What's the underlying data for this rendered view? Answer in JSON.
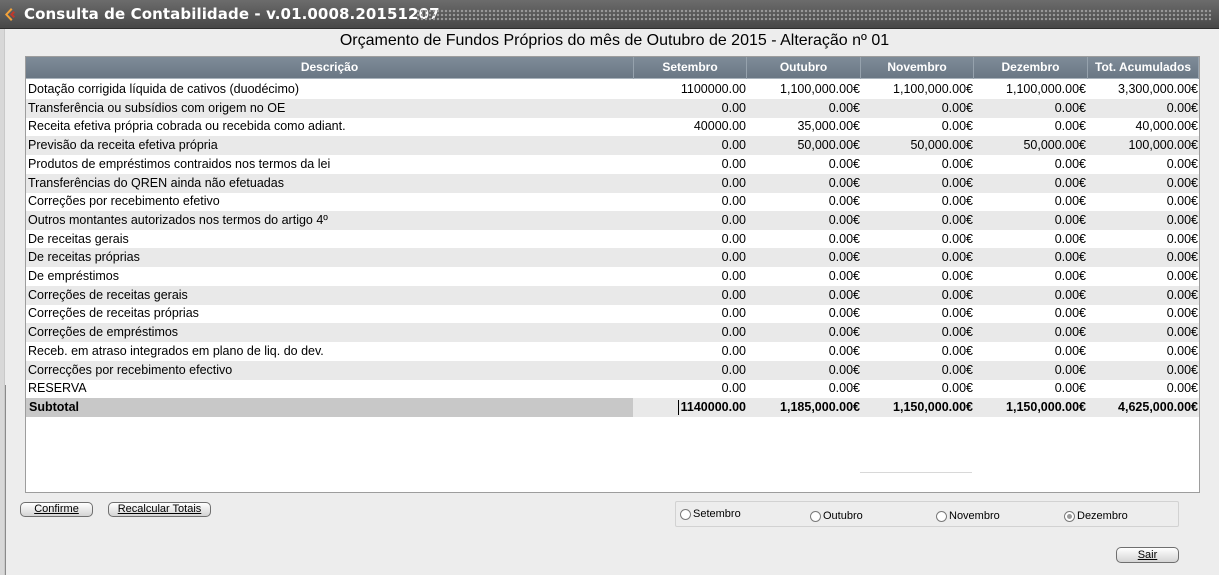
{
  "window": {
    "title": "Consulta de Contabilidade - v.01.0008.20151207"
  },
  "heading": "Orçamento de Fundos Próprios do mês de Outubro de 2015 - Alteração nº 01",
  "table": {
    "columns": [
      "Descrição",
      "Setembro",
      "Outubro",
      "Novembro",
      "Dezembro",
      "Tot. Acumulados"
    ],
    "rows": [
      [
        "Dotação corrigida líquida de cativos (duodécimo)",
        "1100000.00",
        "1,100,000.00€",
        "1,100,000.00€",
        "1,100,000.00€",
        "3,300,000.00€"
      ],
      [
        "Transferência ou subsídios com origem no OE",
        "0.00",
        "0.00€",
        "0.00€",
        "0.00€",
        "0.00€"
      ],
      [
        "Receita efetiva própria cobrada ou recebida como adiant.",
        "40000.00",
        "35,000.00€",
        "0.00€",
        "0.00€",
        "40,000.00€"
      ],
      [
        "Previsão da receita efetiva própria",
        "0.00",
        "50,000.00€",
        "50,000.00€",
        "50,000.00€",
        "100,000.00€"
      ],
      [
        "Produtos de empréstimos contraidos nos termos da lei",
        "0.00",
        "0.00€",
        "0.00€",
        "0.00€",
        "0.00€"
      ],
      [
        "Transferências do QREN ainda não efetuadas",
        "0.00",
        "0.00€",
        "0.00€",
        "0.00€",
        "0.00€"
      ],
      [
        "Correções por recebimento efetivo",
        "0.00",
        "0.00€",
        "0.00€",
        "0.00€",
        "0.00€"
      ],
      [
        "Outros montantes autorizados nos termos do artigo 4º",
        "0.00",
        "0.00€",
        "0.00€",
        "0.00€",
        "0.00€"
      ],
      [
        "De receitas gerais",
        "0.00",
        "0.00€",
        "0.00€",
        "0.00€",
        "0.00€"
      ],
      [
        "De receitas próprias",
        "0.00",
        "0.00€",
        "0.00€",
        "0.00€",
        "0.00€"
      ],
      [
        "De empréstimos",
        "0.00",
        "0.00€",
        "0.00€",
        "0.00€",
        "0.00€"
      ],
      [
        "Correções de receitas gerais",
        "0.00",
        "0.00€",
        "0.00€",
        "0.00€",
        "0.00€"
      ],
      [
        "Correções de receitas próprias",
        "0.00",
        "0.00€",
        "0.00€",
        "0.00€",
        "0.00€"
      ],
      [
        "Correções de empréstimos",
        "0.00",
        "0.00€",
        "0.00€",
        "0.00€",
        "0.00€"
      ],
      [
        "Receb. em atraso integrados em plano de liq. do dev.",
        "0.00",
        "0.00€",
        "0.00€",
        "0.00€",
        "0.00€"
      ],
      [
        "Correcções por recebimento efectivo",
        "0.00",
        "0.00€",
        "0.00€",
        "0.00€",
        "0.00€"
      ],
      [
        "RESERVA",
        "0.00",
        "0.00€",
        "0.00€",
        "0.00€",
        "0.00€"
      ]
    ],
    "subtotal": [
      "Subtotal",
      "1140000.00",
      "1,185,000.00€",
      "1,150,000.00€",
      "1,150,000.00€",
      "4,625,000.00€"
    ]
  },
  "buttons": {
    "confirm": "Confirme",
    "recalc": "Recalcular Totais",
    "exit": "Sair"
  },
  "month_selector": {
    "options": [
      "Setembro",
      "Outubro",
      "Novembro",
      "Dezembro"
    ],
    "selected": "Dezembro"
  }
}
